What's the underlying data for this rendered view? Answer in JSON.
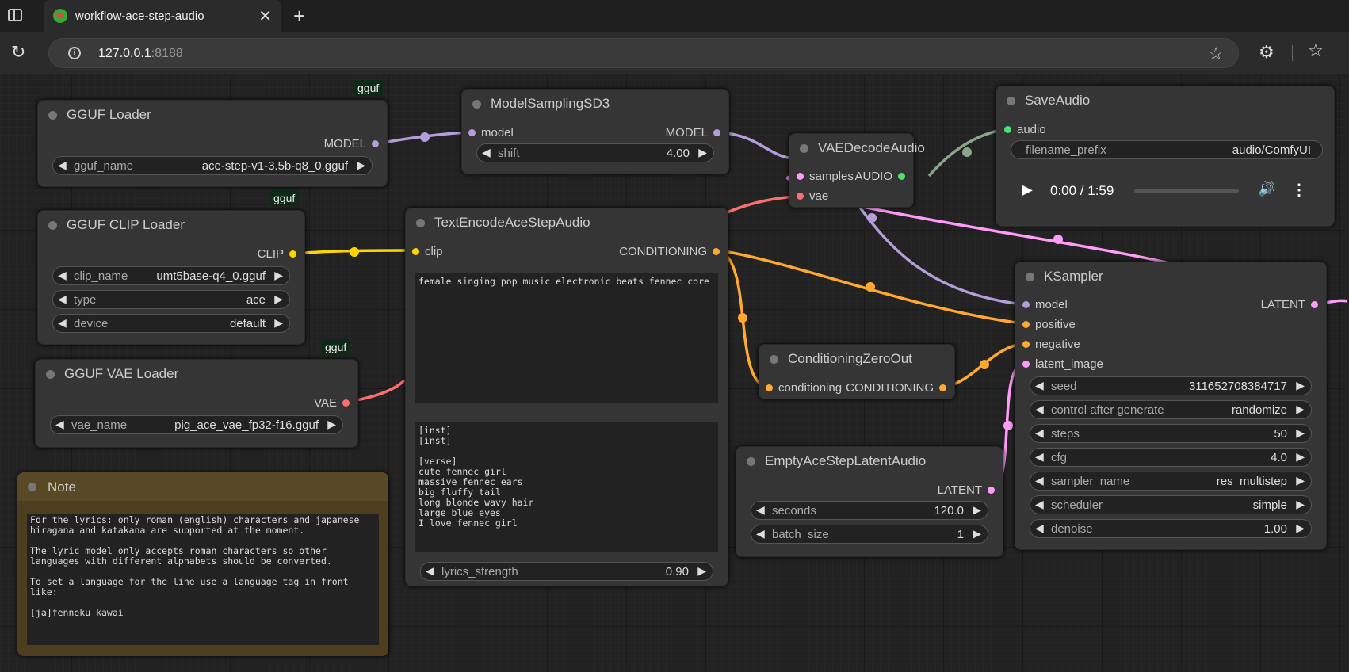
{
  "browser": {
    "tab_title": "workflow-ace-step-audio",
    "tab_close": "✕",
    "new_tab": "+",
    "url_host": "127.0.0.1",
    "url_port": ":8188"
  },
  "badges": {
    "gguf1": "gguf",
    "gguf2": "gguf",
    "gguf3": "gguf"
  },
  "gguf_loader": {
    "title": "GGUF Loader",
    "out": "MODEL",
    "gguf_name_label": "gguf_name",
    "gguf_name": "ace-step-v1-3.5b-q8_0.gguf"
  },
  "model_sampling": {
    "title": "ModelSamplingSD3",
    "in": "model",
    "out": "MODEL",
    "shift_label": "shift",
    "shift": "4.00"
  },
  "vae_decode": {
    "title": "VAEDecodeAudio",
    "in1": "samples",
    "in2": "vae",
    "out": "AUDIO"
  },
  "save_audio": {
    "title": "SaveAudio",
    "in": "audio",
    "prefix_label": "filename_prefix",
    "prefix": "audio/ComfyUI",
    "time": "0:00 / 1:59"
  },
  "clip_loader": {
    "title": "GGUF CLIP Loader",
    "out": "CLIP",
    "clip_name_label": "clip_name",
    "clip_name": "umt5base-q4_0.gguf",
    "type_label": "type",
    "type": "ace",
    "device_label": "device",
    "device": "default"
  },
  "text_encode": {
    "title": "TextEncodeAceStepAudio",
    "in": "clip",
    "out": "CONDITIONING",
    "tags": "female singing pop music electronic beats fennec core",
    "lyrics": "[inst]\n[inst]\n\n[verse]\ncute fennec girl\nmassive fennec ears\nbig fluffy tail\nlong blonde wavy hair\nlarge blue eyes\nI love fennec girl",
    "strength_label": "lyrics_strength",
    "strength": "0.90"
  },
  "vae_loader": {
    "title": "GGUF VAE Loader",
    "out": "VAE",
    "vae_name_label": "vae_name",
    "vae_name": "pig_ace_vae_fp32-f16.gguf"
  },
  "zero_out": {
    "title": "ConditioningZeroOut",
    "in": "conditioning",
    "out": "CONDITIONING"
  },
  "ksampler": {
    "title": "KSampler",
    "in_model": "model",
    "in_pos": "positive",
    "in_neg": "negative",
    "in_latent": "latent_image",
    "out": "LATENT",
    "widgets": [
      {
        "label": "seed",
        "value": "311652708384717"
      },
      {
        "label": "control after generate",
        "value": "randomize"
      },
      {
        "label": "steps",
        "value": "50"
      },
      {
        "label": "cfg",
        "value": "4.0"
      },
      {
        "label": "sampler_name",
        "value": "res_multistep"
      },
      {
        "label": "scheduler",
        "value": "simple"
      },
      {
        "label": "denoise",
        "value": "1.00"
      }
    ]
  },
  "empty_latent": {
    "title": "EmptyAceStepLatentAudio",
    "out": "LATENT",
    "seconds_label": "seconds",
    "seconds": "120.0",
    "batch_label": "batch_size",
    "batch": "1"
  },
  "note": {
    "title": "Note",
    "text": "For the lyrics: only roman (english) characters and japanese\nhiragana and katakana are supported at the moment.\n\nThe lyric model only accepts roman characters so other\nlanguages with different alphabets should be converted.\n\nTo set a language for the line use a language tag in front\nlike:\n\n[ja]fenneku kawai"
  },
  "colors": {
    "model": "#b39ddb",
    "clip": "#ffd500",
    "conditioning": "#ffa931",
    "vae": "#ff6e6e",
    "latent": "#ff9cf9",
    "audio": "#8aa68a"
  }
}
